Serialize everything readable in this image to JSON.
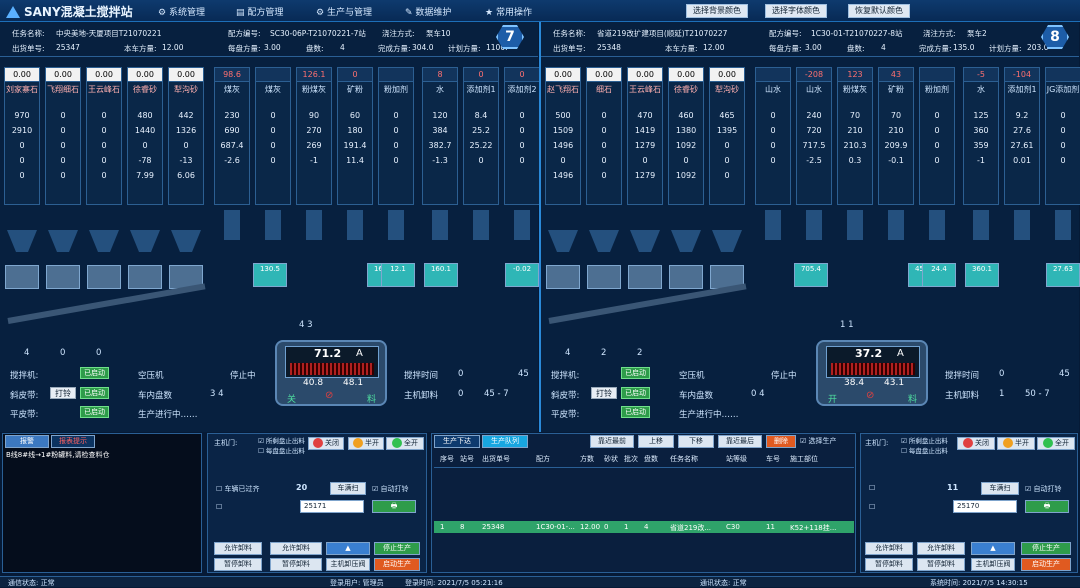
{
  "app": {
    "title": "SANY混凝土搅拌站"
  },
  "menu": [
    {
      "icon": "gear-icon",
      "label": "系统管理"
    },
    {
      "icon": "document-icon",
      "label": "配方管理"
    },
    {
      "icon": "gear-icon",
      "label": "生产与管理"
    },
    {
      "icon": "wrench-icon",
      "label": "数据维护"
    },
    {
      "icon": "star-icon",
      "label": "常用操作"
    }
  ],
  "top_buttons": [
    "选择背景颜色",
    "选择字体颜色",
    "恢复默认颜色"
  ],
  "lines": [
    {
      "number": "7",
      "info1": [
        "任务名称:",
        "中央美地-天厦项目T21070221",
        "配方编号:",
        "SC30-06P-T21070221-7站",
        "浇注方式:",
        "泵车10"
      ],
      "info2": [
        "出货单号:",
        "25347",
        "本车方量:",
        "12.00",
        "每盘方量:",
        "3.00",
        "盘数:",
        "4",
        "完成方量:",
        "304.0",
        "计划方量:",
        "1100."
      ],
      "aggregates": [
        {
          "rv": "0.00",
          "name": "刘家寨石",
          "vals": [
            "970",
            "2910",
            "0",
            "0",
            "0"
          ]
        },
        {
          "rv": "0.00",
          "name": "飞翔细石",
          "vals": [
            "0",
            "0",
            "0",
            "0",
            "0"
          ]
        },
        {
          "rv": "0.00",
          "name": "王云峰石",
          "vals": [
            "0",
            "0",
            "0",
            "0",
            "0"
          ]
        },
        {
          "rv": "0.00",
          "name": "徐睿砂",
          "vals": [
            "480",
            "1440",
            "0",
            "-78",
            "7.99"
          ]
        },
        {
          "rv": "0.00",
          "name": "犁沟砂",
          "vals": [
            "442",
            "1326",
            "0",
            "-13",
            "6.06"
          ]
        }
      ],
      "powders": [
        {
          "rv": "98.6",
          "name": "煤灰",
          "vals": [
            "230",
            "690",
            "687.4",
            "-2.6"
          ]
        },
        {
          "rv": "",
          "name": "煤灰",
          "vals": [
            "0",
            "0",
            "0",
            "0"
          ]
        },
        {
          "rv": "126.1",
          "name": "粉煤灰",
          "vals": [
            "90",
            "270",
            "269",
            "-1"
          ]
        },
        {
          "rv": "0",
          "name": "矿粉",
          "vals": [
            "60",
            "180",
            "191.4",
            "11.4"
          ]
        },
        {
          "rv": "",
          "name": "粉加剂",
          "vals": [
            "0",
            "0",
            "0",
            "0"
          ]
        },
        {
          "rv": "8",
          "name": "水",
          "vals": [
            "120",
            "384",
            "382.7",
            "-1.3"
          ]
        },
        {
          "rv": "0",
          "name": "添加剂1",
          "vals": [
            "8.4",
            "25.2",
            "25.22",
            "0"
          ]
        },
        {
          "rv": "0",
          "name": "添加剂2",
          "vals": [
            "0",
            "0",
            "0",
            "0"
          ]
        }
      ],
      "bins": [
        "130.5",
        "163.9",
        "12.1",
        "160.1",
        "-0.02"
      ],
      "mixer": {
        "current": "71.2",
        "unit": "A",
        "left": "40.8",
        "right": "48.1",
        "lbl_l": "关",
        "lbl_r": "料",
        "top": "4   3"
      },
      "counts": [
        "4",
        "0",
        "0"
      ],
      "status": {
        "mixer_lbl": "搅拌机:",
        "mixer_state": "已启动",
        "belt_lbl": "斜皮带:",
        "belt_btn": "打铃",
        "belt_state": "已启动",
        "flat_lbl": "平皮带:",
        "flat_state": "已启动",
        "air_lbl": "空压机",
        "air_state": "停止中",
        "count_lbl": "车内盘数",
        "count_val": "3    4",
        "prod_lbl": "生产进行中……",
        "mix_time_lbl": "搅拌时间",
        "mix_time": "0",
        "mix_time2": "45",
        "discharge_lbl": "主机卸料",
        "discharge": "0",
        "discharge2": "45  -  7"
      }
    },
    {
      "number": "8",
      "info1": [
        "任务名称:",
        "省道219改扩建项目(顺延)T21070227",
        "配方编号:",
        "1C30-01-T21070227-8站",
        "浇注方式:",
        "泵车2"
      ],
      "info2": [
        "出货单号:",
        "25348",
        "本车方量:",
        "12.00",
        "每盘方量:",
        "3.00",
        "盘数:",
        "4",
        "完成方量:",
        "135.0",
        "计划方量:",
        "203.0"
      ],
      "aggregates": [
        {
          "rv": "0.00",
          "name": "赵飞翔石",
          "vals": [
            "500",
            "1509",
            "1496",
            "0",
            "1496"
          ]
        },
        {
          "rv": "0.00",
          "name": "细石",
          "vals": [
            "0",
            "0",
            "0",
            "0",
            "0"
          ]
        },
        {
          "rv": "0.00",
          "name": "王云峰石",
          "vals": [
            "470",
            "1419",
            "1279",
            "0",
            "1279"
          ]
        },
        {
          "rv": "0.00",
          "name": "徐睿砂",
          "vals": [
            "460",
            "1380",
            "1092",
            "0",
            "1092"
          ]
        },
        {
          "rv": "0.00",
          "name": "犁沟砂",
          "vals": [
            "465",
            "1395",
            "0",
            "0",
            "0"
          ]
        }
      ],
      "powders": [
        {
          "rv": "",
          "name": "山水",
          "vals": [
            "0",
            "0",
            "0",
            "0"
          ]
        },
        {
          "rv": "-208",
          "name": "山水",
          "vals": [
            "240",
            "720",
            "717.5",
            "-2.5"
          ]
        },
        {
          "rv": "123",
          "name": "粉煤灰",
          "vals": [
            "70",
            "210",
            "210.3",
            "0.3"
          ]
        },
        {
          "rv": "43",
          "name": "矿粉",
          "vals": [
            "70",
            "210",
            "209.9",
            "-0.1"
          ]
        },
        {
          "rv": "",
          "name": "粉加剂",
          "vals": [
            "0",
            "0",
            "0",
            "0"
          ]
        },
        {
          "rv": "-5",
          "name": "水",
          "vals": [
            "125",
            "360",
            "359",
            "-1"
          ]
        },
        {
          "rv": "-104",
          "name": "添加剂1",
          "vals": [
            "9.2",
            "27.6",
            "27.61",
            "0.01"
          ]
        },
        {
          "rv": "",
          "name": "JG添加剂",
          "vals": [
            "0",
            "0",
            "0",
            "0"
          ]
        }
      ],
      "bins": [
        "705.4",
        "457.2",
        "24.4",
        "360.1",
        "27.63"
      ],
      "mixer": {
        "current": "37.2",
        "unit": "A",
        "left": "38.4",
        "right": "43.1",
        "lbl_l": "开",
        "lbl_r": "料",
        "top": "1   1"
      },
      "counts": [
        "4",
        "2",
        "2"
      ],
      "status": {
        "mixer_lbl": "搅拌机:",
        "mixer_state": "已启动",
        "belt_lbl": "斜皮带:",
        "belt_btn": "打铃",
        "belt_state": "已启动",
        "flat_lbl": "平皮带:",
        "flat_state": "已启动",
        "air_lbl": "空压机",
        "air_state": "停止中",
        "count_lbl": "车内盘数",
        "count_val": "0    4",
        "prod_lbl": "生产进行中……",
        "mix_time_lbl": "搅拌时间",
        "mix_time": "0",
        "mix_time2": "45",
        "discharge_lbl": "主机卸料",
        "discharge": "1",
        "discharge2": "50  -  7"
      }
    }
  ],
  "bottom": {
    "log_tabs": [
      "报警",
      "报表提示"
    ],
    "log_text": "B线8#线→1#粉罐料,请检查料仓",
    "door": {
      "label": "主机门:",
      "cb1": "所剩盘止出料",
      "cb2": "每盘盘止出料",
      "btn_close": "关闭",
      "btn_half": "半开",
      "btn_open": "全开"
    },
    "car_left": {
      "label": "车辆已过齐",
      "val": "20",
      "btn": "车满扫",
      "auto": "自动打铃",
      "select": "25171"
    },
    "car_right": {
      "val": "11",
      "btn": "车满扫",
      "auto": "自动打铃",
      "select": "25170"
    },
    "left_btns": [
      "允许卸料",
      "允许卸料",
      "主机卸压阀",
      "停止生产",
      "暂停卸料",
      "暂停卸料",
      "主机卸压阀",
      "启动生产"
    ],
    "prod_tabs": [
      "生产下达",
      "生产队列"
    ],
    "prod_tools": [
      "靠近最前",
      "上移",
      "下移",
      "靠近最后",
      "删除",
      "选择生产"
    ],
    "headers": [
      "序号",
      "站号",
      "出货单号",
      "配方",
      "方数",
      "砂状",
      "批次",
      "盘数",
      "任务名称",
      "站等级",
      "车号",
      "施工部位"
    ],
    "row": [
      "1",
      "8",
      "25348",
      "1C30-01-...",
      "12.00",
      "0",
      "1",
      "4",
      "省道219改...",
      "C30",
      "11",
      "K52+118挂..."
    ]
  },
  "statusbar": [
    "通信状态: 正常",
    "登录用户: 管理员",
    "登录时间: 2021/7/5 05:21:16",
    "通讯状态: 正常",
    "系统时间: 2021/7/5 14:30:15"
  ]
}
